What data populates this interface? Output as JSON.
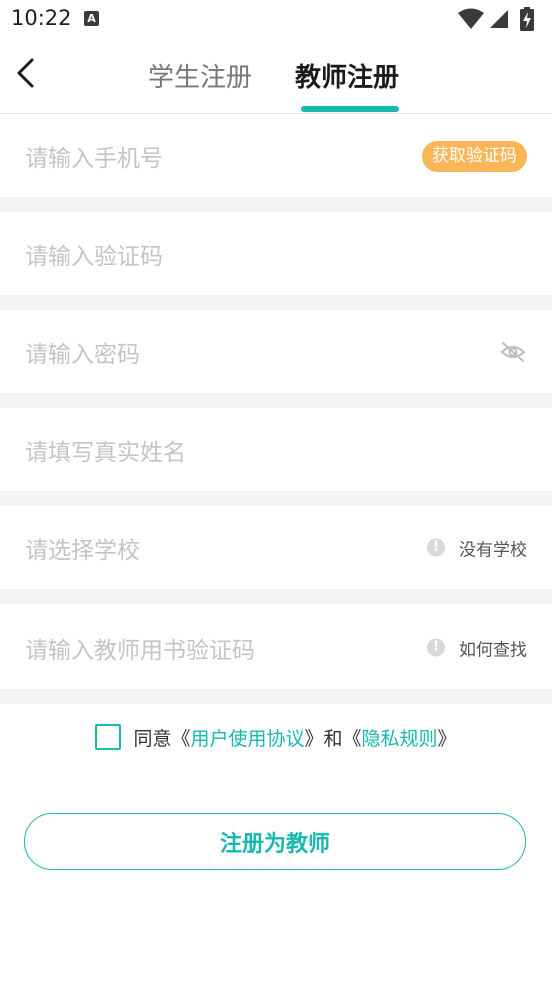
{
  "status_bar": {
    "time": "10:22",
    "notification_badge": "A",
    "icons": [
      "wifi-icon",
      "cellular-signal-icon",
      "battery-charging-icon"
    ]
  },
  "header": {
    "back_icon": "chevron-left-icon",
    "tabs": [
      {
        "label": "学生注册",
        "active": false
      },
      {
        "label": "教师注册",
        "active": true
      }
    ]
  },
  "form": {
    "phone": {
      "placeholder": "请输入手机号",
      "action_label": "获取验证码"
    },
    "verify_code": {
      "placeholder": "请输入验证码"
    },
    "password": {
      "placeholder": "请输入密码",
      "icon": "eye-off-icon"
    },
    "real_name": {
      "placeholder": "请填写真实姓名"
    },
    "school": {
      "placeholder": "请选择学校",
      "hint_icon": "exclamation-circle-icon",
      "hint_label": "没有学校"
    },
    "book_code": {
      "placeholder": "请输入教师用书验证码",
      "hint_icon": "exclamation-circle-icon",
      "hint_label": "如何查找"
    }
  },
  "agreement": {
    "prefix": "同意",
    "open_bracket_1": "《",
    "user_agreement": "用户使用协议",
    "close_bracket_1": "》",
    "conjunction": "和",
    "open_bracket_2": "《",
    "privacy_rules": "隐私规则",
    "close_bracket_2": "》",
    "checked": false
  },
  "register_button": {
    "label": "注册为教师"
  },
  "colors": {
    "accent": "#16b8b0",
    "code_button": "#f9b659",
    "placeholder": "#c4c4c4",
    "divider": "#f3f3f3"
  }
}
